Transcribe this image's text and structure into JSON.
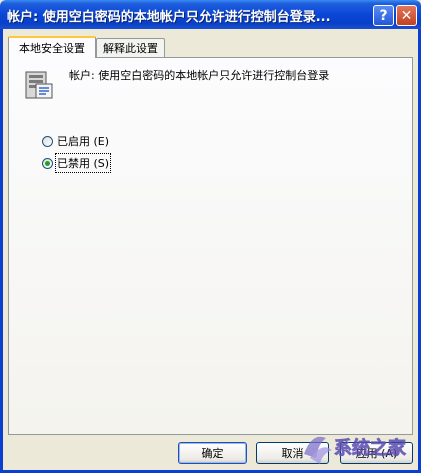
{
  "window": {
    "title": "帐户: 使用空白密码的本地帐户只允许进行控制台登录...",
    "help_label": "?",
    "close_label": "✕"
  },
  "tabs": [
    {
      "label": "本地安全设置",
      "active": true
    },
    {
      "label": "解释此设置",
      "active": false
    }
  ],
  "policy": {
    "icon": "policy-icon",
    "description": "帐户: 使用空白密码的本地帐户只允许进行控制台登录"
  },
  "options": [
    {
      "label": "已启用 (E)",
      "checked": false
    },
    {
      "label": "已禁用 (S)",
      "checked": true
    }
  ],
  "buttons": {
    "ok": "确定",
    "cancel": "取消",
    "apply": "应用 (A)"
  },
  "watermark": {
    "text": "系统之家"
  },
  "colors": {
    "titlebar": "#0a46d8",
    "dialog_bg": "#ece9d8",
    "tab_highlight": "#ffc73c",
    "radio_checked": "#21a121"
  }
}
